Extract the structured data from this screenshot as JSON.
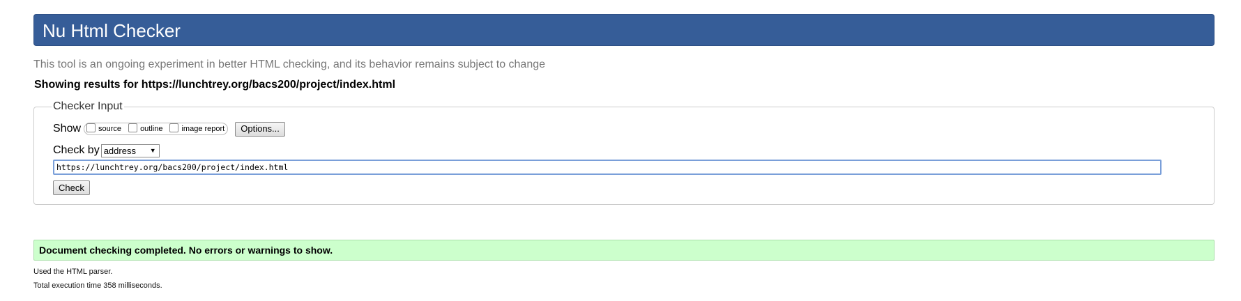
{
  "header": {
    "title": "Nu Html Checker"
  },
  "tagline": "This tool is an ongoing experiment in better HTML checking, and its behavior remains subject to change",
  "showing_results": "Showing results for https://lunchtrey.org/bacs200/project/index.html",
  "checker_input": {
    "legend": "Checker Input",
    "show_label": "Show",
    "show_options": [
      {
        "label": "source",
        "checked": false
      },
      {
        "label": "outline",
        "checked": false
      },
      {
        "label": "image report",
        "checked": false
      }
    ],
    "options_button": "Options...",
    "check_by_label": "Check by",
    "check_by_value": "address",
    "url_value": "https://lunchtrey.org/bacs200/project/index.html",
    "check_button": "Check"
  },
  "result": {
    "message": "Document checking completed. No errors or warnings to show.",
    "parser_note": "Used the HTML parser.",
    "execution_time": "Total execution time 358 milliseconds."
  },
  "colors": {
    "header_bg": "#365d98",
    "success_bg": "#ccffcc"
  }
}
